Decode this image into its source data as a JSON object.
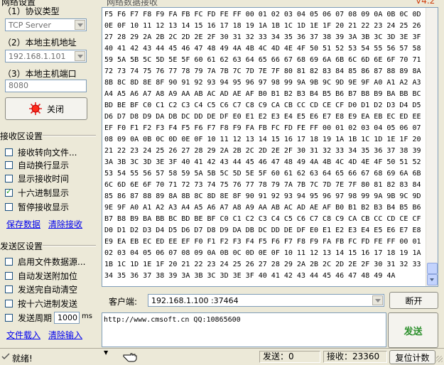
{
  "net_settings": {
    "group_title": "网络设置",
    "protocol_label": "（1）协议类型",
    "protocol_value": "TCP Server",
    "host_ip_label": "（2）本地主机地址",
    "host_ip_value": "192.168.1.101",
    "host_port_label": "（3）本地主机端口",
    "host_port_value": "8080",
    "close_button": "关闭"
  },
  "receive_settings": {
    "group_title": "接收区设置",
    "options": [
      {
        "label": "接收转向文件...",
        "checked": false
      },
      {
        "label": "自动换行显示",
        "checked": false
      },
      {
        "label": "显示接收时间",
        "checked": false
      },
      {
        "label": "十六进制显示",
        "checked": true
      },
      {
        "label": "暂停接收显示",
        "checked": false
      }
    ],
    "save_link": "保存数据",
    "clear_link": "清除接收"
  },
  "send_settings": {
    "group_title": "发送区设置",
    "options": [
      {
        "label": "启用文件数据源...",
        "checked": false
      },
      {
        "label": "自动发送附加位",
        "checked": false
      },
      {
        "label": "发送完自动清空",
        "checked": false
      },
      {
        "label": "按十六进制发送",
        "checked": false
      }
    ],
    "period_label": "发送周期",
    "period_value": "1000",
    "period_unit": "ms",
    "file_load_link": "文件载入",
    "clear_input_link": "清除输入"
  },
  "receive_area": {
    "title": "网络数据接收",
    "version": "V4.2",
    "lines": [
      "F5 F6 F7 F8 F9 FA FB FC FD FE FF 00 01 02 03 04 05 06 07 08 09 0A 0B 0C 0D",
      "0E 0F 10 11 12 13 14 15 16 17 18 19 1A 1B 1C 1D 1E 1F 20 21 22 23 24 25 26",
      "27 28 29 2A 2B 2C 2D 2E 2F 30 31 32 33 34 35 36 37 38 39 3A 3B 3C 3D 3E 3F",
      "40 41 42 43 44 45 46 47 48 49 4A 4B 4C 4D 4E 4F 50 51 52 53 54 55 56 57 58",
      "59 5A 5B 5C 5D 5E 5F 60 61 62 63 64 65 66 67 68 69 6A 6B 6C 6D 6E 6F 70 71",
      "72 73 74 75 76 77 78 79 7A 7B 7C 7D 7E 7F 80 81 82 83 84 85 86 87 88 89 8A",
      "8B 8C 8D 8E 8F 90 91 92 93 94 95 96 97 98 99 9A 9B 9C 9D 9E 9F A0 A1 A2 A3",
      "A4 A5 A6 A7 A8 A9 AA AB AC AD AE AF B0 B1 B2 B3 B4 B5 B6 B7 B8 B9 BA BB BC",
      "BD BE BF C0 C1 C2 C3 C4 C5 C6 C7 C8 C9 CA CB CC CD CE CF D0 D1 D2 D3 D4 D5",
      "D6 D7 D8 D9 DA DB DC DD DE DF E0 E1 E2 E3 E4 E5 E6 E7 E8 E9 EA EB EC ED EE",
      "EF F0 F1 F2 F3 F4 F5 F6 F7 F8 F9 FA FB FC FD FE FF 00 01 02 03 04 05 06 07",
      "08 09 0A 0B 0C 0D 0E 0F 10 11 12 13 14 15 16 17 18 19 1A 1B 1C 1D 1E 1F 20",
      "21 22 23 24 25 26 27 28 29 2A 2B 2C 2D 2E 2F 30 31 32 33 34 35 36 37 38 39",
      "3A 3B 3C 3D 3E 3F 40 41 42 43 44 45 46 47 48 49 4A 4B 4C 4D 4E 4F 50 51 52",
      "53 54 55 56 57 58 59 5A 5B 5C 5D 5E 5F 60 61 62 63 64 65 66 67 68 69 6A 6B",
      "6C 6D 6E 6F 70 71 72 73 74 75 76 77 78 79 7A 7B 7C 7D 7E 7F 80 81 82 83 84",
      "85 86 87 88 89 8A 8B 8C 8D 8E 8F 90 91 92 93 94 95 96 97 98 99 9A 9B 9C 9D",
      "9E 9F A0 A1 A2 A3 A4 A5 A6 A7 A8 A9 AA AB AC AD AE AF B0 B1 B2 B3 B4 B5 B6",
      "B7 B8 B9 BA BB BC BD BE BF C0 C1 C2 C3 C4 C5 C6 C7 C8 C9 CA CB CC CD CE CF",
      "D0 D1 D2 D3 D4 D5 D6 D7 D8 D9 DA DB DC DD DE DF E0 E1 E2 E3 E4 E5 E6 E7 E8",
      "E9 EA EB EC ED EE EF F0 F1 F2 F3 F4 F5 F6 F7 F8 F9 FA FB FC FD FE FF 00 01",
      "02 03 04 05 06 07 08 09 0A 0B 0C 0D 0E 0F 10 11 12 13 14 15 16 17 18 19 1A",
      "1B 1C 1D 1E 1F 20 21 22 23 24 25 26 27 28 29 2A 2B 2C 2D 2E 2F 30 31 32 33",
      "34 35 36 37 38 39 3A 3B 3C 3D 3E 3F 40 41 42 43 44 45 46 47 48 49 4A"
    ]
  },
  "client_bar": {
    "label": "客户端:",
    "value": "192.168.1.100 :37464",
    "disconnect_button": "断开"
  },
  "send_area": {
    "text": "http://www.cmsoft.cn QQ:10865600",
    "send_button": "发送"
  },
  "status_bar": {
    "ready": "就绪!",
    "send_label": "发送：0",
    "recv_label": "接收：23360",
    "reset_button": "复位计数"
  },
  "colors": {
    "window_bg": "#ece9d8",
    "link": "#0000ee",
    "send_button_text": "#2a8f2a",
    "close_icon": "#e82020",
    "version": "#d04010"
  }
}
